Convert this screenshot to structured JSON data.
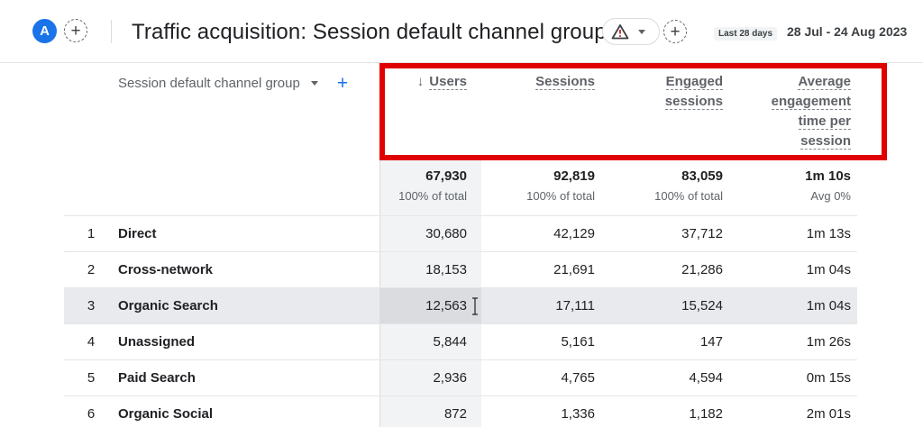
{
  "header": {
    "avatar_letter": "A",
    "add_comparison_symbol": "+",
    "title": "Traffic acquisition: Session default channel group",
    "warning_icon": "warning-icon",
    "add_symbol": "+",
    "range_label": "Last 28 days",
    "date_range": "28 Jul - 24 Aug 2023"
  },
  "table": {
    "dimension_header": "Session default channel group",
    "add_dimension_symbol": "+",
    "columns": {
      "users": "Users",
      "users_sort_arrow": "↓",
      "sessions": "Sessions",
      "engaged_sessions_1": "Engaged",
      "engaged_sessions_2": "sessions",
      "avg_1": "Average",
      "avg_2": "engagement",
      "avg_3": "time per",
      "avg_4": "session"
    },
    "totals": {
      "users": "67,930",
      "users_pct": "100% of total",
      "sessions": "92,819",
      "sessions_pct": "100% of total",
      "engaged": "83,059",
      "engaged_pct": "100% of total",
      "avg": "1m 10s",
      "avg_pct": "Avg 0%"
    },
    "rows": [
      {
        "num": "1",
        "name": "Direct",
        "users": "30,680",
        "sessions": "42,129",
        "engaged": "37,712",
        "avg": "1m 13s"
      },
      {
        "num": "2",
        "name": "Cross-network",
        "users": "18,153",
        "sessions": "21,691",
        "engaged": "21,286",
        "avg": "1m 04s"
      },
      {
        "num": "3",
        "name": "Organic Search",
        "users": "12,563",
        "sessions": "17,111",
        "engaged": "15,524",
        "avg": "1m 04s"
      },
      {
        "num": "4",
        "name": "Unassigned",
        "users": "5,844",
        "sessions": "5,161",
        "engaged": "147",
        "avg": "1m 26s"
      },
      {
        "num": "5",
        "name": "Paid Search",
        "users": "2,936",
        "sessions": "4,765",
        "engaged": "4,594",
        "avg": "0m 15s"
      },
      {
        "num": "6",
        "name": "Organic Social",
        "users": "872",
        "sessions": "1,336",
        "engaged": "1,182",
        "avg": "2m 01s"
      }
    ],
    "highlighted_row": "3"
  },
  "colors": {
    "accent": "#1a73e8",
    "highlight_border": "#e00000"
  }
}
